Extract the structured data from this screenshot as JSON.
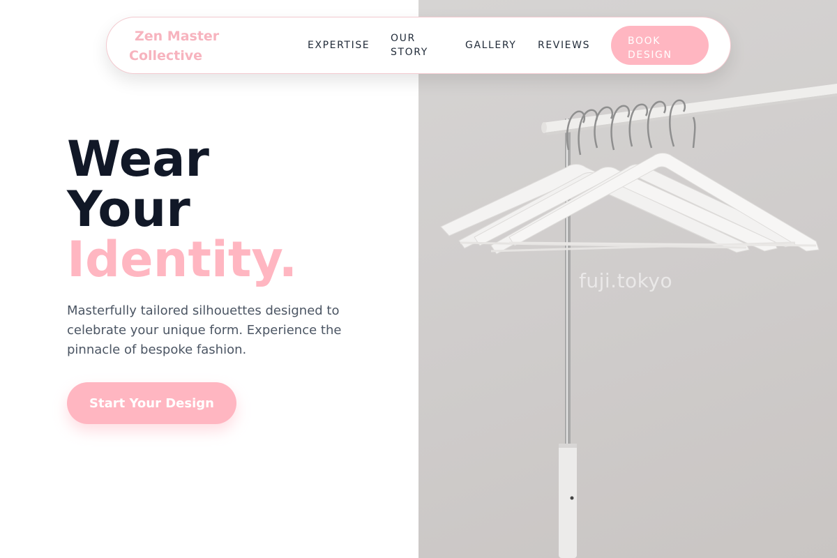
{
  "brand": {
    "name": "Zen Master Collective",
    "accent_color": "#ffb6c1",
    "text_color": "#111827"
  },
  "nav": {
    "links": [
      {
        "label": "EXPERTISE"
      },
      {
        "label": "OUR STORY"
      },
      {
        "label": "GALLERY"
      },
      {
        "label": "REVIEWS"
      }
    ],
    "cta_label": "BOOK DESIGN"
  },
  "hero": {
    "title_line1": "Wear",
    "title_line2": "Your",
    "title_accent": "Identity.",
    "description": "Masterfully tailored silhouettes designed to celebrate your unique form. Experience the pinnacle of bespoke fashion.",
    "cta_label": "Start Your Design"
  },
  "image": {
    "subject": "white clothes hangers on a metal rack",
    "watermark": "fuji.tokyo"
  }
}
